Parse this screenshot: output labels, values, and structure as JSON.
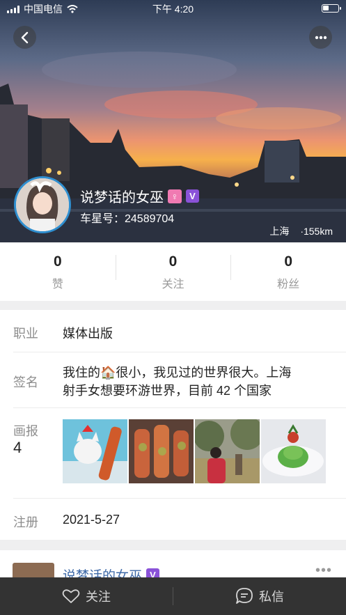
{
  "status_bar": {
    "carrier": "中国电信",
    "time": "下午 4:20"
  },
  "profile": {
    "name": "说梦话的女巫",
    "gender_badge": "♀",
    "verified_badge": "V",
    "star_id": "车星号：24589704",
    "city": "上海",
    "distance": "·155km"
  },
  "stats": [
    {
      "value": "0",
      "label": "赞"
    },
    {
      "value": "0",
      "label": "关注"
    },
    {
      "value": "0",
      "label": "粉丝"
    }
  ],
  "info": {
    "job_label": "职业",
    "job_value": "媒体出版",
    "sign_label": "签名",
    "sign_line1": "我住的🏠很小，我见过的世界很大。上海",
    "sign_line2": "射手女想要环游世界，目前 42 个国家",
    "album_label": "画报",
    "album_count": "4",
    "register_label": "注册",
    "register_value": "2021-5-27"
  },
  "post": {
    "author": "说梦话的女巫",
    "verified_badge": "V",
    "more": "•••"
  },
  "bottom_bar": {
    "follow_label": "关注",
    "message_label": "私信"
  },
  "colors": {
    "accent_purple": "#8a52d8",
    "female_pink": "#f07ab2",
    "link_blue": "#3f6aa8",
    "bottom_bar": "#333333"
  }
}
